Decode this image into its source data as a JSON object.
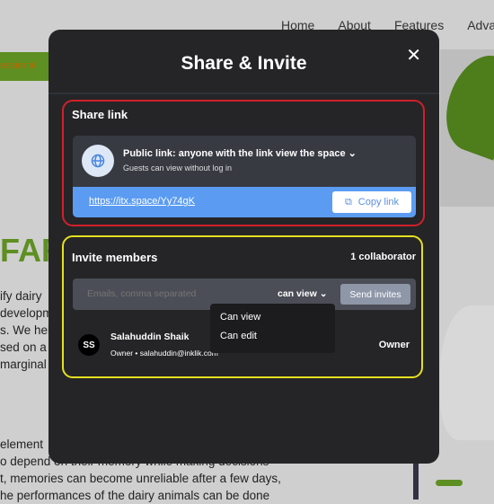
{
  "background": {
    "nav": [
      "Home",
      "About",
      "Features",
      "Adva"
    ],
    "banner_text": "essional",
    "heading_fragment": "FAR",
    "para1": [
      "ify dairy",
      "developm",
      "s. We hel",
      "sed on a",
      "marginal"
    ],
    "para2": [
      "element",
      "o depend on their memory while making decisions",
      "t, memories can become unreliable after a few days,",
      "he performances of the dairy animals can be done"
    ]
  },
  "modal": {
    "title": "Share & Invite",
    "close_icon": "close-icon",
    "share": {
      "title": "Share link",
      "public_link_label": "Public link: anyone with the link view the space",
      "subtitle": "Guests can view without log in",
      "url": "https://itx.space/Yy74gK",
      "copy_label": "Copy link"
    },
    "invite": {
      "title": "Invite members",
      "collaborators": "1 collaborator",
      "email_placeholder": "Emails, comma separated",
      "permission": "can view",
      "send_label": "Send invites",
      "dropdown_options": [
        "Can view",
        "Can edit"
      ],
      "members": [
        {
          "initials": "SS",
          "name": "Salahuddin Shaik",
          "detail": "Owner • salahuddin@inklik.com",
          "role": "Owner"
        }
      ]
    }
  },
  "colors": {
    "share_outline": "#d1202a",
    "invite_outline": "#e6e020",
    "link_bar": "#5b9cf2",
    "brand_green": "#5e8f22"
  }
}
